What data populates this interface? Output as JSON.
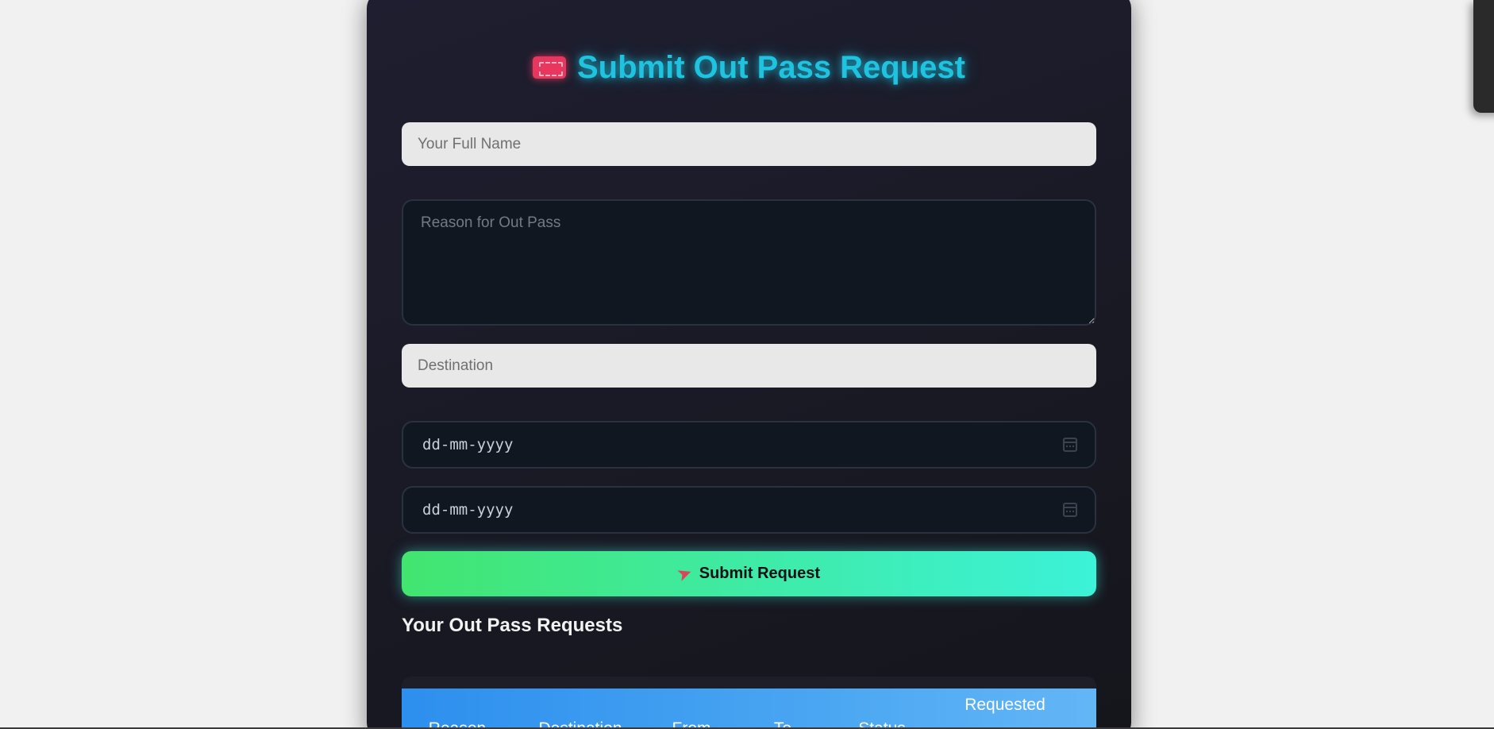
{
  "form": {
    "title": "Submit Out Pass Request",
    "title_icon": "ticket-icon",
    "name_placeholder": "Your Full Name",
    "reason_placeholder": "Reason for Out Pass",
    "destination_placeholder": "Destination",
    "from_date_placeholder": "dd-mm-yyyy",
    "to_date_placeholder": "dd-mm-yyyy",
    "submit_icon": "rocket-icon",
    "submit_label": "Submit Request"
  },
  "requests": {
    "title": "Your Out Pass Requests",
    "columns": [
      "Reason",
      "Destination",
      "From",
      "To",
      "Status",
      "Requested"
    ]
  },
  "colors": {
    "title": "#1fc3e0",
    "submit_gradient_start": "#42e56f",
    "submit_gradient_end": "#3cf2d8",
    "table_header_start": "#2d8fee",
    "table_header_end": "#63b6f6",
    "card_background": "#1a1a26"
  }
}
